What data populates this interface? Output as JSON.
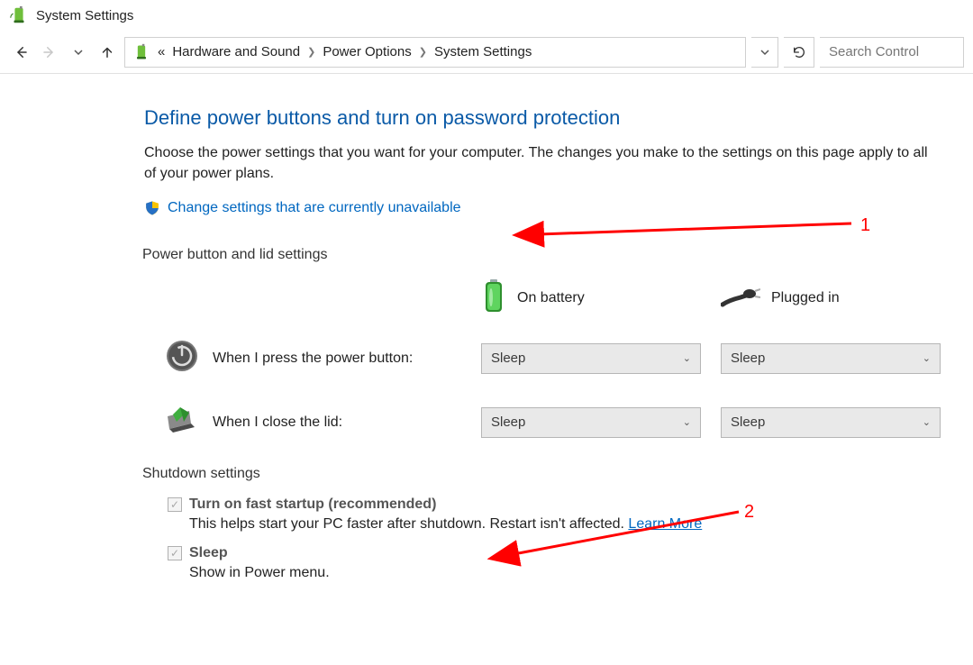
{
  "window": {
    "title": "System Settings"
  },
  "breadcrumb": {
    "overflow": "«",
    "items": [
      "Hardware and Sound",
      "Power Options",
      "System Settings"
    ]
  },
  "search": {
    "placeholder": "Search Control"
  },
  "page": {
    "title": "Define power buttons and turn on password protection",
    "description": "Choose the power settings that you want for your computer. The changes you make to the settings on this page apply to all of your power plans.",
    "admin_link": "Change settings that are currently unavailable"
  },
  "sections": {
    "power_lid": {
      "header": "Power button and lid settings",
      "col_battery": "On battery",
      "col_plugged": "Plugged in",
      "rows": [
        {
          "label": "When I press the power button:",
          "battery": "Sleep",
          "plugged": "Sleep"
        },
        {
          "label": "When I close the lid:",
          "battery": "Sleep",
          "plugged": "Sleep"
        }
      ]
    },
    "shutdown": {
      "header": "Shutdown settings",
      "options": [
        {
          "title": "Turn on fast startup (recommended)",
          "desc": "This helps start your PC faster after shutdown. Restart isn't affected. ",
          "link": "Learn More"
        },
        {
          "title": "Sleep",
          "desc": "Show in Power menu."
        }
      ]
    }
  },
  "annotations": {
    "label1": "1",
    "label2": "2"
  }
}
